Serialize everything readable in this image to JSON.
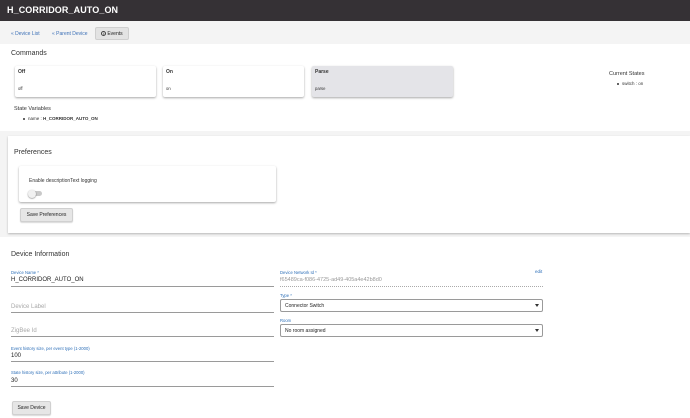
{
  "header": {
    "title": "H_CORRIDOR_AUTO_ON"
  },
  "nav": {
    "device_list": "« Device List",
    "parent_device": "« Parent Device",
    "events": "Events"
  },
  "commands": {
    "heading": "Commands",
    "items": [
      {
        "label": "Off",
        "arg": "off"
      },
      {
        "label": "On",
        "arg": "on"
      },
      {
        "label": "Parse",
        "arg": "parse"
      }
    ]
  },
  "current_states": {
    "heading": "Current States",
    "items": [
      {
        "text": "switch : on"
      }
    ]
  },
  "state_variables": {
    "heading": "State Variables",
    "item_key": "name : ",
    "item_value": "H_CORRIDOR_AUTO_ON"
  },
  "preferences": {
    "heading": "Preferences",
    "option_label": "Enable descriptionText logging",
    "option_enabled": false,
    "save_label": "Save Preferences"
  },
  "device_info": {
    "heading": "Device Information",
    "device_name": {
      "label": "Device Name *",
      "value": "H_CORRIDOR_AUTO_ON"
    },
    "device_label": {
      "placeholder": "Device Label"
    },
    "zigbee_id": {
      "placeholder": "ZigBee Id"
    },
    "event_history": {
      "label": "Event history size, per event type (1-2000)",
      "value": "100"
    },
    "state_history": {
      "label": "State history size, per attribute (1-2000)",
      "value": "30"
    },
    "network_id": {
      "label": "Device Network Id *",
      "value": "f65489ca-f086-4725-ad49-405a4e42b8d0",
      "edit": "edit"
    },
    "type": {
      "label": "Type *",
      "value": "Connector Switch"
    },
    "room": {
      "label": "Room",
      "value": "No room assigned"
    },
    "save_label": "Save Device"
  }
}
